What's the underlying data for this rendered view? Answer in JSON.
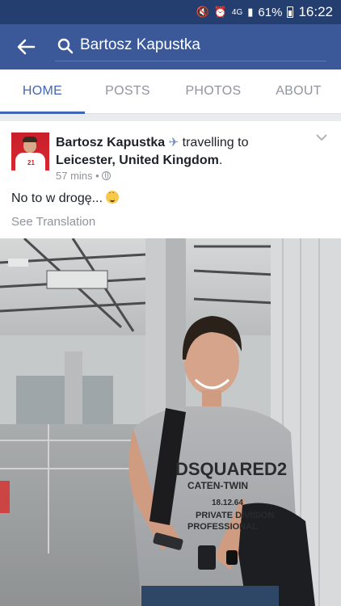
{
  "status_bar": {
    "battery": "61%",
    "time": "16:22",
    "network": "4G"
  },
  "search": {
    "query": "Bartosz Kapustka"
  },
  "tabs": [
    {
      "label": "HOME",
      "active": true
    },
    {
      "label": "POSTS"
    },
    {
      "label": "PHOTOS"
    },
    {
      "label": "ABOUT"
    }
  ],
  "post": {
    "author": "Bartosz Kapustka",
    "activity": "travelling to",
    "place": "Leicester, United Kingdom",
    "time": "57 mins",
    "text": "No to w drogę...",
    "see_translation": "See Translation",
    "shirt_text": [
      "DSQUARED2",
      "CATEN-TWIN",
      "18.12.64",
      "PRIVATE DIVISION",
      "PROFESSIONAL"
    ],
    "jersey_number": "21"
  },
  "colors": {
    "header": "#3b5998",
    "status": "#233e6f",
    "accent": "#4267b2"
  }
}
